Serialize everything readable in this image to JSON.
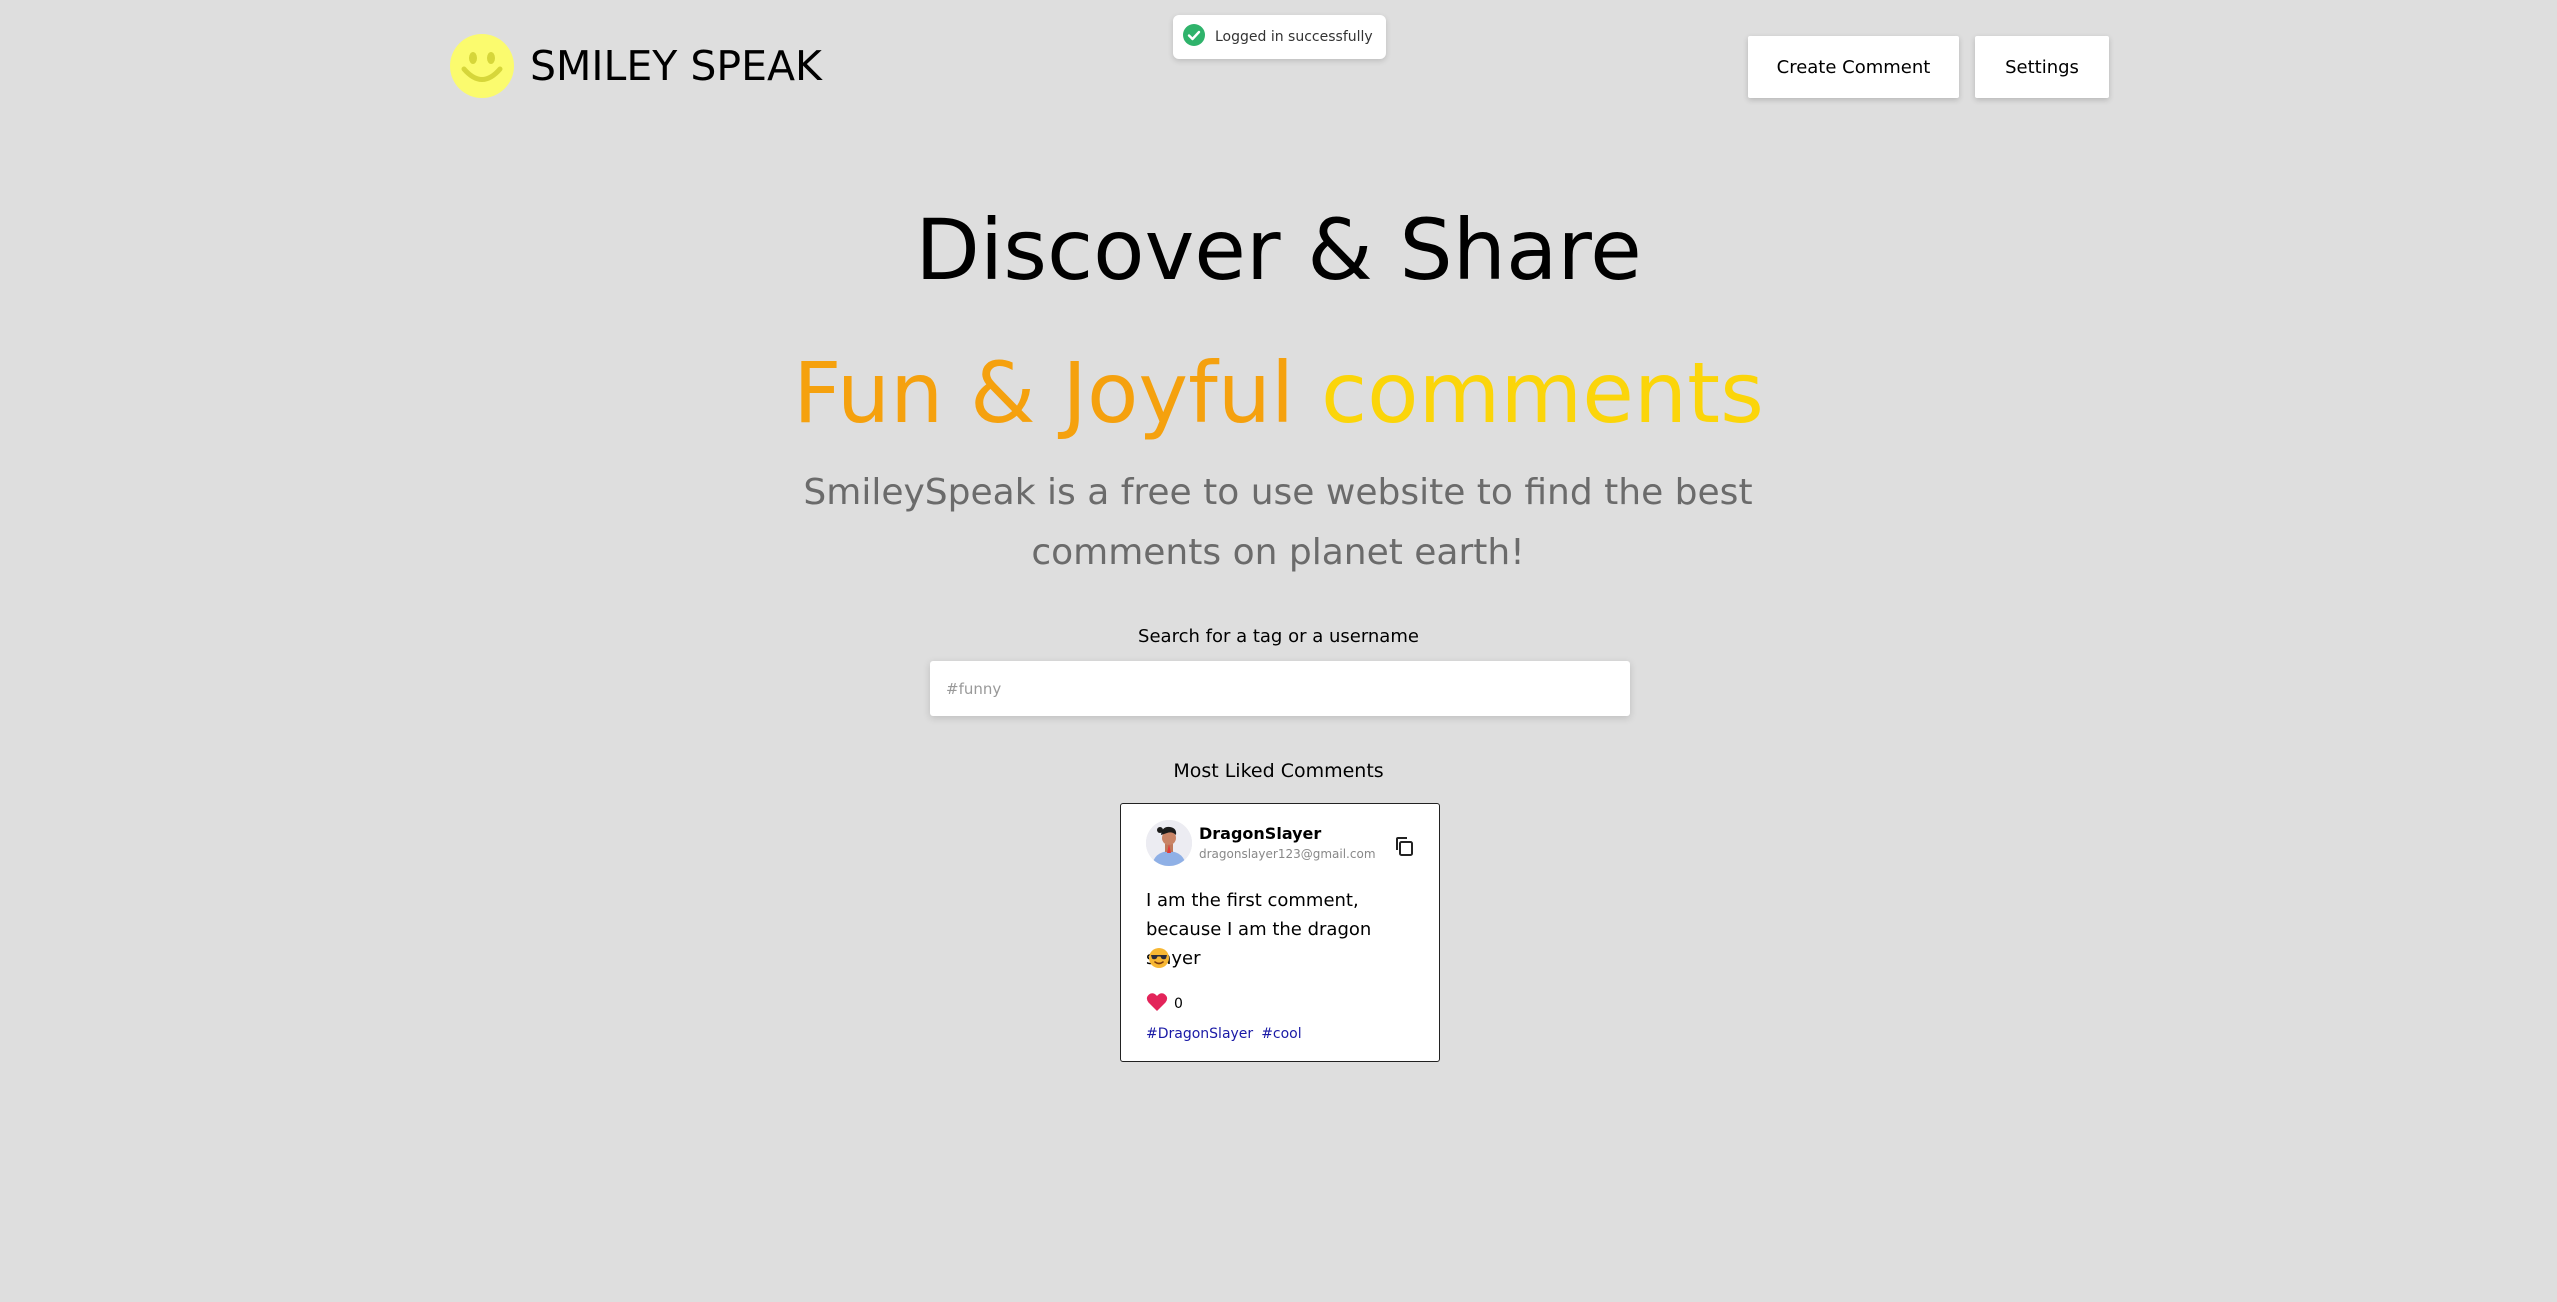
{
  "header": {
    "logo_text": "SMILEY SPEAK",
    "logo_icon": "smiley-face-icon",
    "create_button": "Create Comment",
    "settings_button": "Settings"
  },
  "toast": {
    "message": "Logged in successfully",
    "icon": "check-circle-icon",
    "color": "#2fb36b"
  },
  "hero": {
    "title": "Discover & Share",
    "subtitle_part1": "Fun & Joyful",
    "subtitle_part2": "comments",
    "description": "SmileySpeak is a free to use website to find the best comments on planet earth!"
  },
  "search": {
    "label": "Search for a tag or a username",
    "placeholder": "#funny",
    "value": ""
  },
  "most_liked": {
    "title": "Most Liked Comments",
    "comments": [
      {
        "username": "DragonSlayer",
        "email": "dragonslayer123@gmail.com",
        "text": "I am the first comment, because I am the dragon slayer",
        "emoji": "sunglasses-emoji",
        "likes": "0",
        "tags": [
          "#DragonSlayer",
          "#cool"
        ]
      }
    ]
  },
  "colors": {
    "background": "#dedede",
    "orange": "#f5a10e",
    "yellow": "#fbd50a",
    "logo_yellow": "#fbfb6e",
    "tag_blue": "#1a1aa6",
    "heart": "#e3245a"
  }
}
